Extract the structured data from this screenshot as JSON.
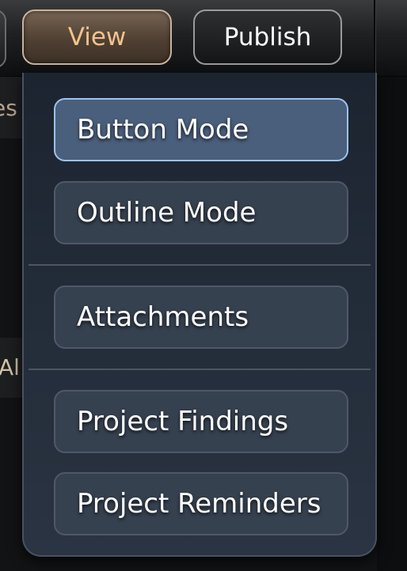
{
  "toolbar": {
    "view_label": "View",
    "publish_label": "Publish"
  },
  "background": {
    "fragment_1": "es",
    "fragment_2": "Al"
  },
  "view_menu": {
    "items": [
      {
        "label": "Button Mode",
        "selected": true
      },
      {
        "label": "Outline Mode",
        "selected": false
      },
      {
        "label": "Attachments",
        "selected": false
      },
      {
        "label": "Project Findings",
        "selected": false
      },
      {
        "label": "Project Reminders",
        "selected": false
      }
    ]
  },
  "colors": {
    "view_button_text": "#f2c28d",
    "active_item_border": "#9cc3ee",
    "menu_background": "#2a3442"
  }
}
